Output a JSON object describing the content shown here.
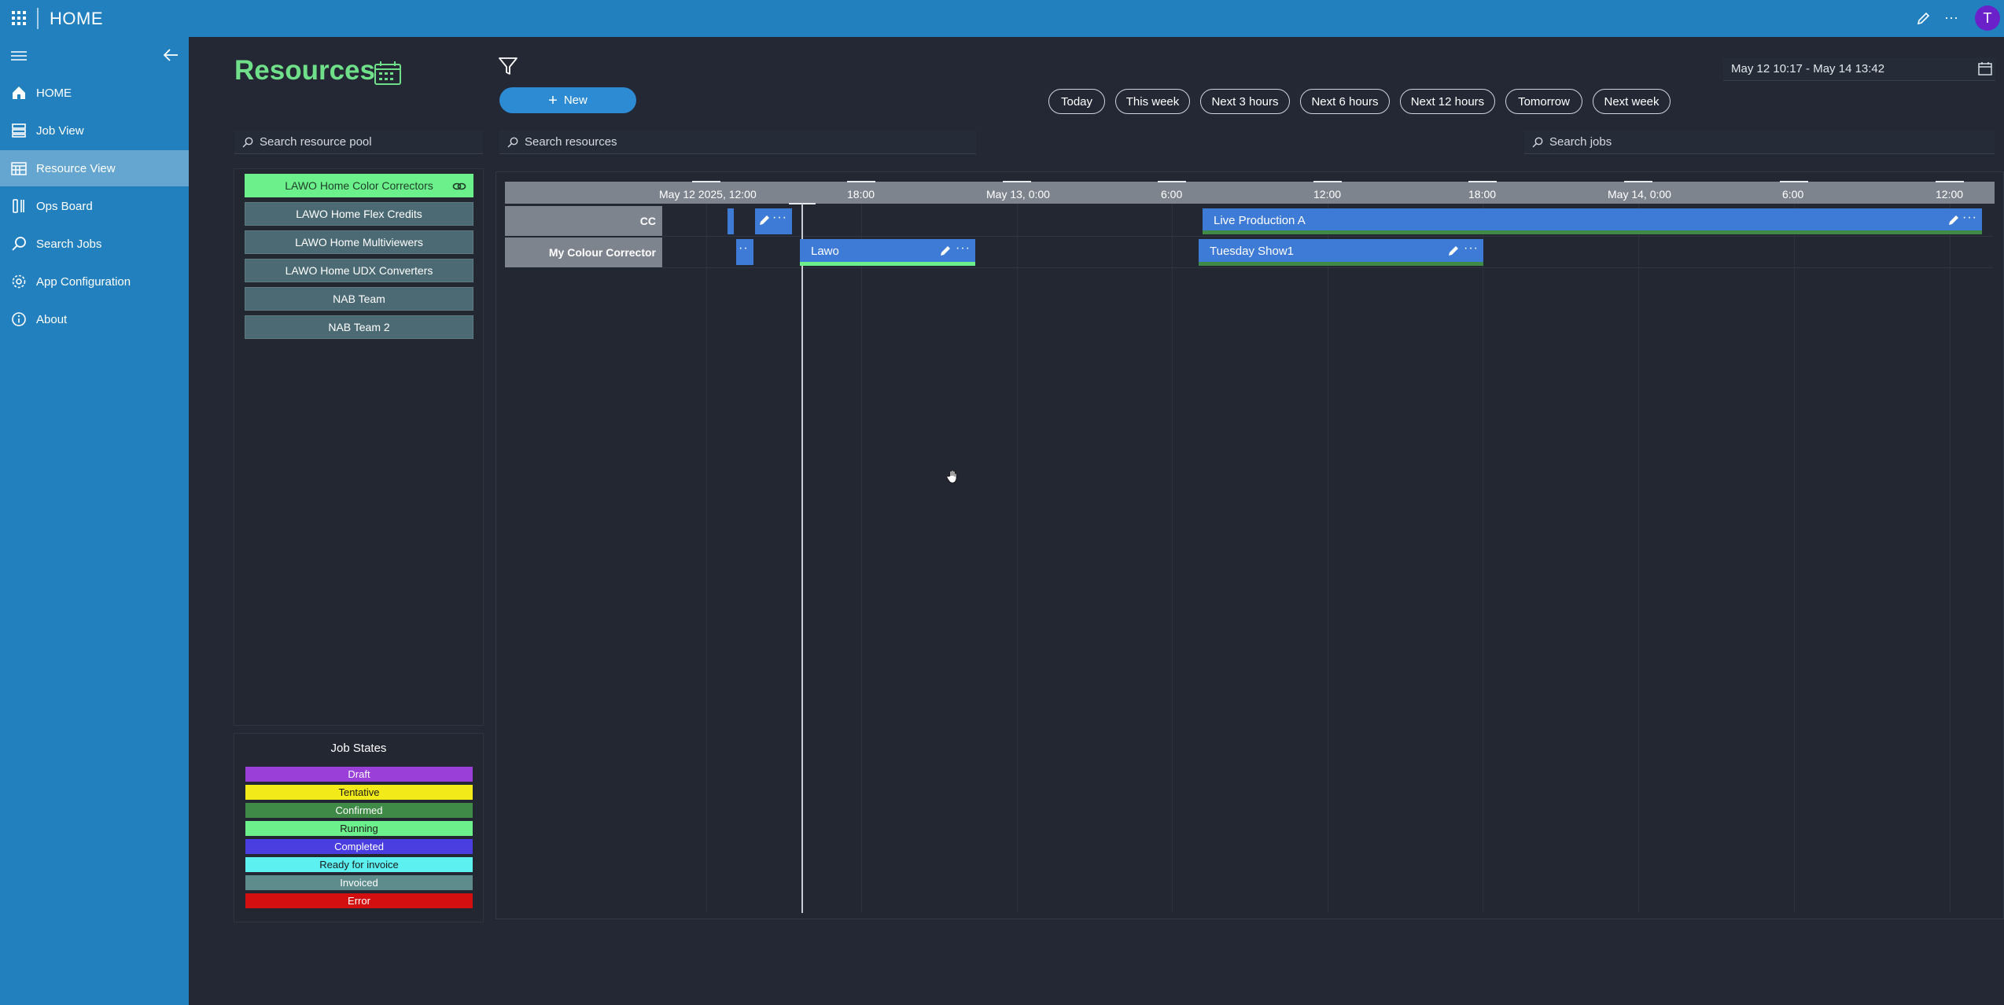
{
  "app": {
    "title": "HOME"
  },
  "sidebar": {
    "items": [
      {
        "label": "HOME",
        "icon": "home-icon"
      },
      {
        "label": "Job View",
        "icon": "job-view-icon"
      },
      {
        "label": "Resource View",
        "icon": "resource-view-icon",
        "active": true
      },
      {
        "label": "Ops Board",
        "icon": "ops-board-icon"
      },
      {
        "label": "Search Jobs",
        "icon": "search-icon"
      },
      {
        "label": "App Configuration",
        "icon": "gear-icon"
      },
      {
        "label": "About",
        "icon": "info-icon"
      }
    ]
  },
  "page": {
    "title": "Resources"
  },
  "toolbar": {
    "new_label": "New",
    "quick_ranges": [
      "Today",
      "This week",
      "Next 3 hours",
      "Next 6 hours",
      "Next 12 hours",
      "Tomorrow",
      "Next week"
    ],
    "date_range": "May 12 10:17 - May 14 13:42"
  },
  "search": {
    "pool_placeholder": "Search resource pool",
    "resources_placeholder": "Search resources",
    "jobs_placeholder": "Search jobs"
  },
  "pool": {
    "items": [
      {
        "label": "LAWO Home Color Correctors",
        "selected": true
      },
      {
        "label": "LAWO Home Flex Credits"
      },
      {
        "label": "LAWO Home Multiviewers"
      },
      {
        "label": "LAWO Home UDX Converters"
      },
      {
        "label": "NAB Team"
      },
      {
        "label": "NAB Team 2"
      }
    ]
  },
  "legend": {
    "title": "Job States",
    "items": [
      {
        "label": "Draft",
        "color": "#9b3fd9",
        "text_color": "#ffffff"
      },
      {
        "label": "Tentative",
        "color": "#f2ea19",
        "text_color": "#1b1b1b"
      },
      {
        "label": "Confirmed",
        "color": "#3e8a46",
        "text_color": "#ffffff"
      },
      {
        "label": "Running",
        "color": "#6cf08c",
        "text_color": "#1b1b1b"
      },
      {
        "label": "Completed",
        "color": "#4a3ee0",
        "text_color": "#ffffff"
      },
      {
        "label": "Ready for invoice",
        "color": "#5cf0f0",
        "text_color": "#1b1b1b"
      },
      {
        "label": "Invoiced",
        "color": "#5e8c8c",
        "text_color": "#ffffff"
      },
      {
        "label": "Error",
        "color": "#d40f0f",
        "text_color": "#ffffff"
      }
    ]
  },
  "timeline": {
    "ticks": [
      "May 12 2025, 12:00",
      "18:00",
      "May 13, 0:00",
      "6:00",
      "12:00",
      "18:00",
      "May 14, 0:00",
      "6:00",
      "12:00"
    ],
    "rows": [
      "CC",
      "My Colour Corrector"
    ],
    "jobs": [
      {
        "label": "Live Production A",
        "state_color": "#3e8a46"
      },
      {
        "label": "Lawo",
        "state_color": "#6cf08c"
      },
      {
        "label": "Tuesday Show1",
        "state_color": "#3e8a46"
      }
    ]
  }
}
